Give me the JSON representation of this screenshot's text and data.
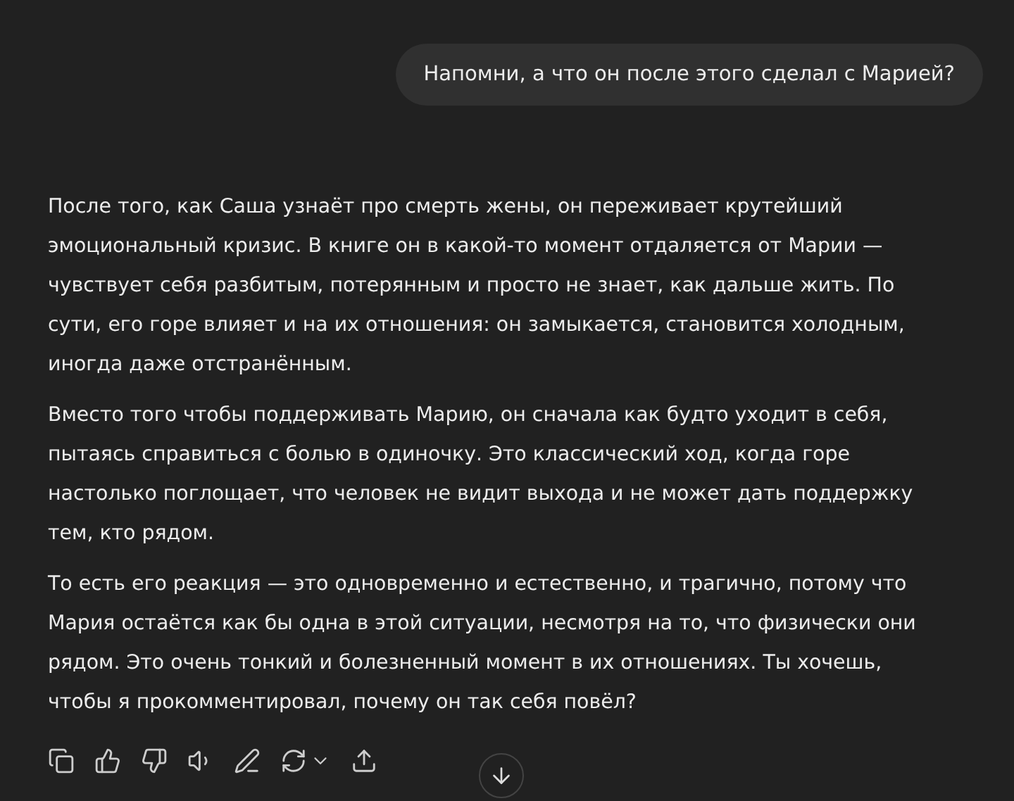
{
  "user_message": "Напомни, а что он после этого сделал с Марией?",
  "assistant_message": {
    "paragraphs": [
      "После того, как Саша узнаёт про смерть жены, он переживает крутейший эмоциональный кризис. В книге он в какой-то момент отдаляется от Марии — чувствует себя разбитым, потерянным и просто не знает, как дальше жить. По сути, его горе влияет и на их отношения: он замыкается, становится холодным, иногда даже отстранённым.",
      "Вместо того чтобы поддерживать Марию, он сначала как будто уходит в себя, пытаясь справиться с болью в одиночку. Это классический ход, когда горе настолько поглощает, что человек не видит выхода и не может дать поддержку тем, кто рядом.",
      "То есть его реакция — это одновременно и естественно, и трагично, потому что Мария остаётся как бы одна в этой ситуации, несмотря на то, что физически они рядом. Это очень тонкий и болезненный момент в их отношениях. Ты хочешь, чтобы я прокомментировал, почему он так себя повёл?"
    ]
  }
}
